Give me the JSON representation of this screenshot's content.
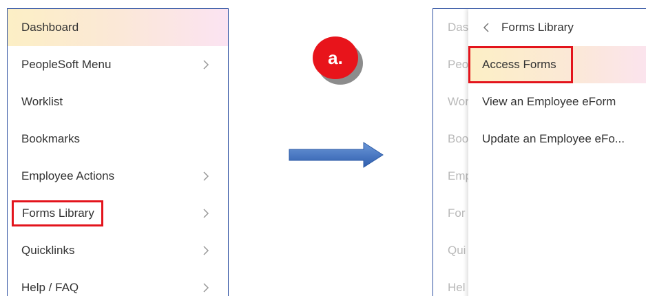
{
  "left_menu": {
    "items": [
      {
        "label": "Dashboard",
        "has_submenu": false,
        "active": true
      },
      {
        "label": "PeopleSoft Menu",
        "has_submenu": true
      },
      {
        "label": "Worklist",
        "has_submenu": false
      },
      {
        "label": "Bookmarks",
        "has_submenu": false
      },
      {
        "label": "Employee Actions",
        "has_submenu": true
      },
      {
        "label": "Forms Library",
        "has_submenu": true,
        "highlighted": true
      },
      {
        "label": "Quicklinks",
        "has_submenu": true
      },
      {
        "label": "Help / FAQ",
        "has_submenu": true
      }
    ]
  },
  "badge": {
    "label": "a."
  },
  "arrow": {
    "icon": "right-arrow-icon",
    "color": "#4a7ac7"
  },
  "right_menu": {
    "behind_items": [
      "Das",
      "Peo",
      "Wor",
      "Boo",
      "Emp",
      "For",
      "Qui",
      "Hel"
    ],
    "header": {
      "back_icon": "chevron-left-icon",
      "title": "Forms Library"
    },
    "items": [
      {
        "label": "Access Forms",
        "active": true,
        "highlighted": true
      },
      {
        "label": "View an Employee eForm"
      },
      {
        "label": "Update an Employee eFo..."
      }
    ]
  },
  "colors": {
    "panel_border": "#2b4ea0",
    "highlight_red": "#e3141c",
    "badge_red": "#e8141b",
    "active_gradient_start": "#fcefc5",
    "active_gradient_end": "#fbe3f2",
    "text": "#333333",
    "faded_text": "#b9b9b9"
  }
}
